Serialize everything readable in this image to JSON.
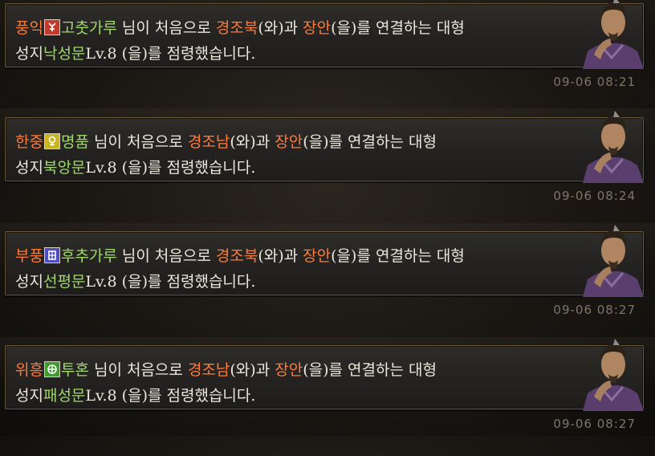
{
  "messages": [
    {
      "faction": "풍익",
      "emblem_icon": "red-faction-icon",
      "emblem_color": "#c23a2e",
      "player": "고춧가루",
      "text_a": " 님이 처음으로 ",
      "city_from": "경조북",
      "text_b": "(와)과 ",
      "city_to": "장안",
      "text_c": "(을)를 연결하는 대형",
      "line2_prefix": "성지",
      "gate": "낙성문",
      "line2_suffix": "Lv.8 (을)를 점령했습니다.",
      "time": "09-06 08:21"
    },
    {
      "faction": "한중",
      "emblem_icon": "yellow-faction-icon",
      "emblem_color": "#c9b520",
      "player": "명품",
      "text_a": " 님이 처음으로 ",
      "city_from": "경조남",
      "text_b": "(와)과 ",
      "city_to": "장안",
      "text_c": "(을)를 연결하는 대형",
      "line2_prefix": "성지",
      "gate": "북앙문",
      "line2_suffix": "Lv.8 (을)를 점령했습니다.",
      "time": "09-06 08:24"
    },
    {
      "faction": "부풍",
      "emblem_icon": "blue-faction-icon",
      "emblem_color": "#4b4fc2",
      "player": "후추가루",
      "text_a": " 님이 처음으로 ",
      "city_from": "경조북",
      "text_b": "(와)과 ",
      "city_to": "장안",
      "text_c": "(을)를 연결하는 대형",
      "line2_prefix": "성지",
      "gate": "선평문",
      "line2_suffix": "Lv.8 (을)를 점령했습니다.",
      "time": "09-06 08:27"
    },
    {
      "faction": "위흥",
      "emblem_icon": "green-faction-icon",
      "emblem_color": "#3f9a2f",
      "player": "투혼",
      "text_a": " 님이 처음으로 ",
      "city_from": "경조남",
      "text_b": "(와)과 ",
      "city_to": "장안",
      "text_c": "(을)를 연결하는 대형",
      "line2_prefix": "성지",
      "gate": "패성문",
      "line2_suffix": "Lv.8 (을)를 점령했습니다.",
      "time": "09-06 08:27"
    }
  ],
  "colors": {
    "faction_text": "#ff7a3a",
    "player_text": "#9fd86b",
    "body_text": "#ece7dc",
    "timestamp": "#7d7568",
    "card_border": "#6a5a3c"
  },
  "icons": {
    "portrait": "advisor-portrait-icon"
  }
}
